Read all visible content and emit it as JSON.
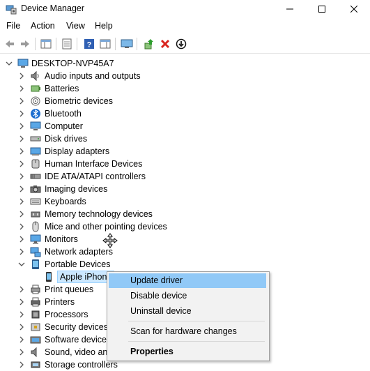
{
  "window": {
    "title": "Device Manager",
    "minimize": "—",
    "maximize": "☐",
    "close": "✕"
  },
  "menu": [
    "File",
    "Action",
    "View",
    "Help"
  ],
  "tree": {
    "root": "DESKTOP-NVP45A7",
    "categories": [
      {
        "label": "Audio inputs and outputs",
        "icon": "speaker-icon"
      },
      {
        "label": "Batteries",
        "icon": "battery-icon"
      },
      {
        "label": "Biometric devices",
        "icon": "fingerprint-icon"
      },
      {
        "label": "Bluetooth",
        "icon": "bluetooth-icon"
      },
      {
        "label": "Computer",
        "icon": "computer-icon"
      },
      {
        "label": "Disk drives",
        "icon": "disk-drive-icon"
      },
      {
        "label": "Display adapters",
        "icon": "display-adapter-icon"
      },
      {
        "label": "Human Interface Devices",
        "icon": "hid-icon"
      },
      {
        "label": "IDE ATA/ATAPI controllers",
        "icon": "ide-controller-icon"
      },
      {
        "label": "Imaging devices",
        "icon": "camera-icon"
      },
      {
        "label": "Keyboards",
        "icon": "keyboard-icon"
      },
      {
        "label": "Memory technology devices",
        "icon": "memory-icon"
      },
      {
        "label": "Mice and other pointing devices",
        "icon": "mouse-icon"
      },
      {
        "label": "Monitors",
        "icon": "monitor-icon"
      },
      {
        "label": "Network adapters",
        "icon": "network-adapter-icon"
      },
      {
        "label": "Portable Devices",
        "icon": "portable-device-icon",
        "expanded": true
      },
      {
        "label": "Apple iPhone",
        "icon": "phone-icon",
        "child": true
      },
      {
        "label": "Print queues",
        "icon": "print-queue-icon"
      },
      {
        "label": "Printers",
        "icon": "printer-icon"
      },
      {
        "label": "Processors",
        "icon": "processor-icon"
      },
      {
        "label": "Security devices",
        "icon": "security-device-icon"
      },
      {
        "label": "Software devices",
        "icon": "software-device-icon"
      },
      {
        "label": "Sound, video and game controllers",
        "icon": "sound-controller-icon"
      },
      {
        "label": "Storage controllers",
        "icon": "storage-controller-icon"
      }
    ]
  },
  "context_menu": {
    "items": [
      "Update driver",
      "Disable device",
      "Uninstall device",
      "Scan for hardware changes",
      "Properties"
    ]
  },
  "colors": {
    "highlight": "#91c9f7",
    "selection": "#cce8ff",
    "accent": "#0078d7"
  }
}
